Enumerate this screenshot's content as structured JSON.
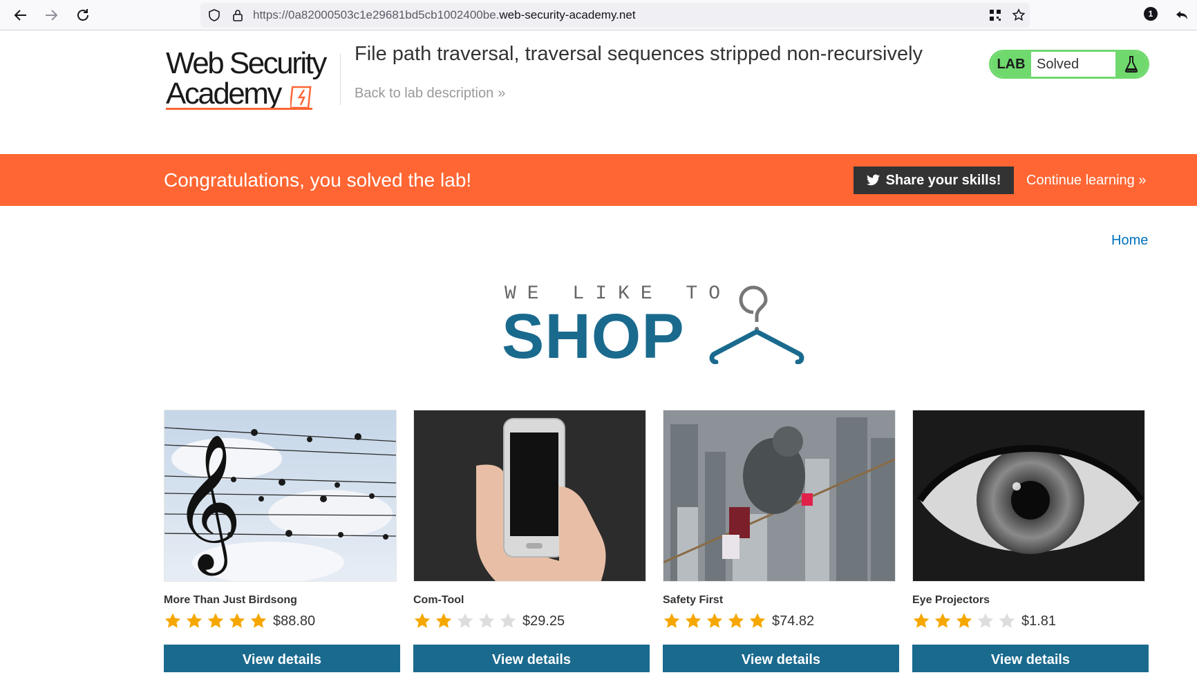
{
  "browser": {
    "url_prefix": "https://0a82000503c1e29681bd5cb1002400be.",
    "url_host": "web-security-academy.net",
    "notification_count": "1"
  },
  "header": {
    "logo_line1": "Web Security",
    "logo_line2": "Academy",
    "title": "File path traversal, traversal sequences stripped non-recursively",
    "back_link": "Back to lab description",
    "lab_tag": "LAB",
    "lab_status": "Solved"
  },
  "banner": {
    "message": "Congratulations, you solved the lab!",
    "share_label": "Share your skills!",
    "continue_label": "Continue learning"
  },
  "nav": {
    "home": "Home"
  },
  "hero": {
    "line1": "WE LIKE TO",
    "line2": "SHOP"
  },
  "products": [
    {
      "name": "More Than Just Birdsong",
      "rating": 5,
      "price": "$88.80",
      "button": "View details"
    },
    {
      "name": "Com-Tool",
      "rating": 2,
      "price": "$29.25",
      "button": "View details"
    },
    {
      "name": "Safety First",
      "rating": 5,
      "price": "$74.82",
      "button": "View details"
    },
    {
      "name": "Eye Projectors",
      "rating": 3,
      "price": "$1.81",
      "button": "View details"
    }
  ],
  "colors": {
    "brand_orange": "#ff6633",
    "lab_green": "#70d96e",
    "shop_blue": "#1a6a8e",
    "link_blue": "#0071bc",
    "star_on": "#f5a700",
    "star_off": "#dddddd"
  }
}
